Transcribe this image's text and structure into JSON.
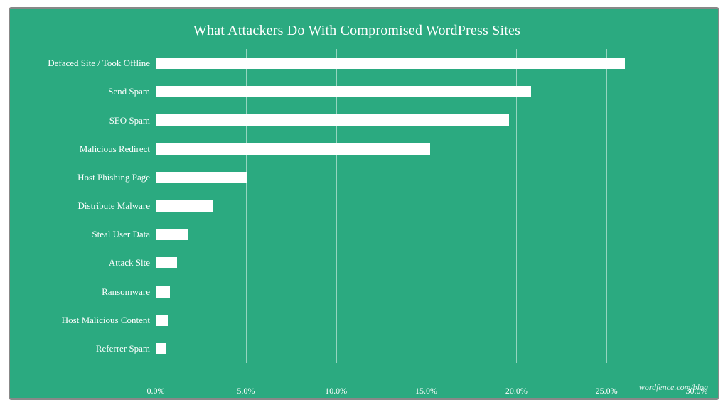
{
  "chart": {
    "title": "What Attackers Do With Compromised WordPress Sites",
    "watermark": "wordfence.com/blog",
    "backgroundColor": "#2baa80",
    "maxValue": 30,
    "xTicks": [
      "0.0%",
      "5.0%",
      "10.0%",
      "15.0%",
      "20.0%",
      "25.0%",
      "30.0%"
    ],
    "bars": [
      {
        "label": "Defaced Site / Took Offline",
        "value": 26.0
      },
      {
        "label": "Send Spam",
        "value": 20.8
      },
      {
        "label": "SEO Spam",
        "value": 19.6
      },
      {
        "label": "Malicious Redirect",
        "value": 15.2
      },
      {
        "label": "Host Phishing Page",
        "value": 5.1
      },
      {
        "label": "Distribute Malware",
        "value": 3.2
      },
      {
        "label": "Steal User Data",
        "value": 1.8
      },
      {
        "label": "Attack Site",
        "value": 1.2
      },
      {
        "label": "Ransomware",
        "value": 0.8
      },
      {
        "label": "Host Malicious Content",
        "value": 0.7
      },
      {
        "label": "Referrer Spam",
        "value": 0.6
      }
    ]
  }
}
